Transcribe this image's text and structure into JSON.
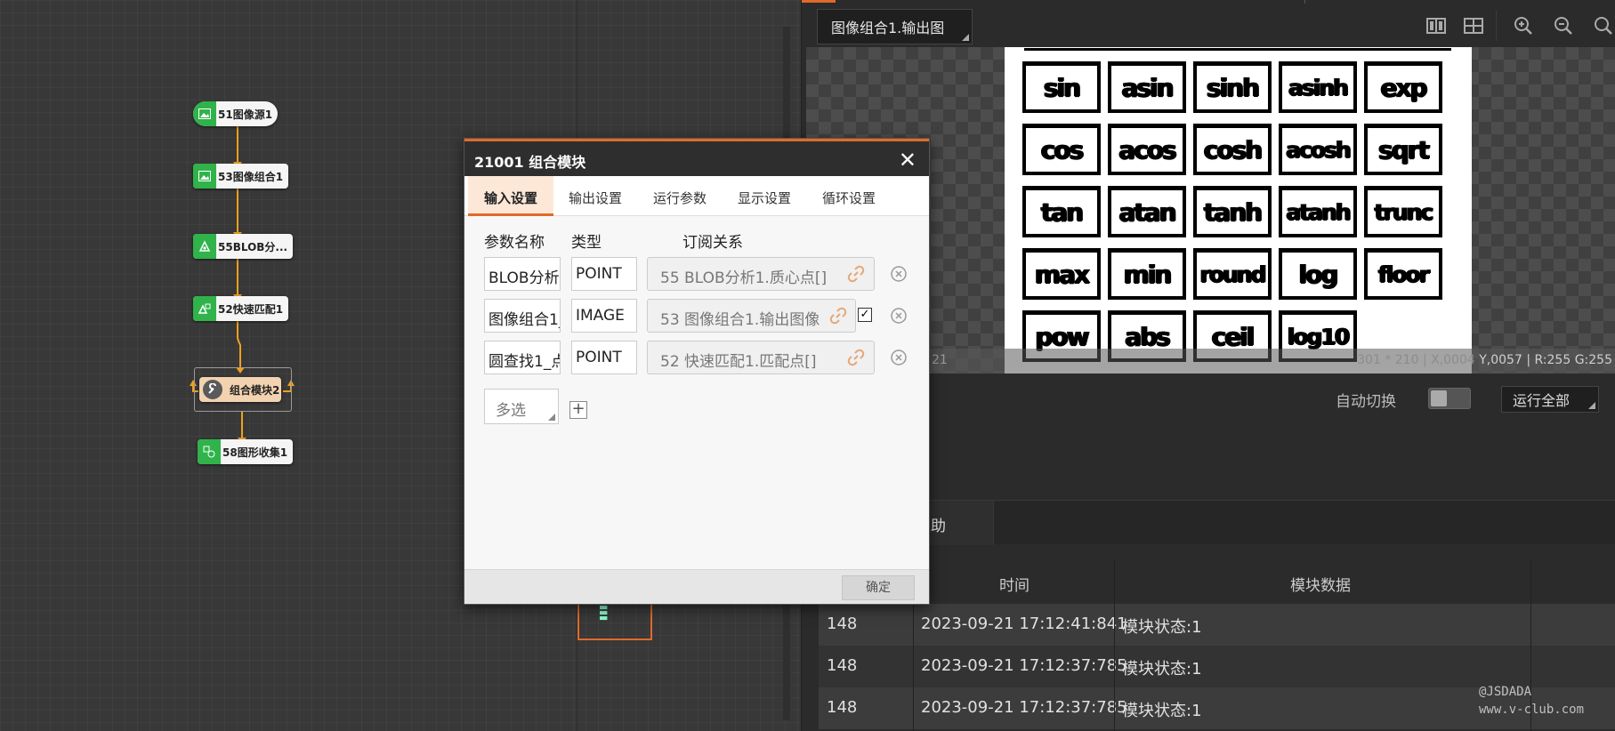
{
  "flow": {
    "nodes": [
      {
        "id": "n1",
        "label": "51图像源1"
      },
      {
        "id": "n2",
        "label": "53图像组合1"
      },
      {
        "id": "n3",
        "label": "55BLOB分..."
      },
      {
        "id": "n4",
        "label": "52快速匹配1"
      },
      {
        "id": "n5",
        "label": "组合模块2"
      },
      {
        "id": "n6",
        "label": "58图形收集1"
      }
    ]
  },
  "dialog": {
    "title": "21001 组合模块",
    "close": "✕",
    "tabs": [
      "输入设置",
      "输出设置",
      "运行参数",
      "显示设置",
      "循环设置"
    ],
    "columns": {
      "name": "参数名称",
      "type": "类型",
      "subscription": "订阅关系"
    },
    "params": [
      {
        "name": "BLOB分析",
        "type": "POINT",
        "subscription": "55 BLOB分析1.质心点[]",
        "checked": false
      },
      {
        "name": "图像组合1_",
        "type": "IMAGE",
        "subscription": "53 图像组合1.输出图像",
        "checked": true
      },
      {
        "name": "圆查找1_点",
        "type": "POINT",
        "subscription": "52 快速匹配1.匹配点[]",
        "checked": false
      }
    ],
    "multi_select": "多选",
    "add": "+",
    "confirm": "确定"
  },
  "viewer": {
    "tab_label": "图像组合1.输出图",
    "preview_words": [
      "sin",
      "asin",
      "sinh",
      "asinh",
      "exp",
      "cos",
      "acos",
      "cosh",
      "acosh",
      "sqrt",
      "tan",
      "atan",
      "tanh",
      "atanh",
      "trunc",
      "max",
      "min",
      "round",
      "log",
      "floor",
      "pow",
      "abs",
      "ceil",
      "log10"
    ],
    "status_left": "21",
    "status_size": "301 * 210",
    "status_x": "X,0004",
    "status_y": "Y,0057",
    "status_r": "R:255",
    "status_g": "G:255"
  },
  "controls": {
    "auto_switch": "自动切换",
    "run_all": "运行全部"
  },
  "bottom": {
    "help_tab": "帮助",
    "table": {
      "headers": [
        "时间",
        "模块数据"
      ],
      "rows": [
        {
          "id": "148",
          "time": "2023-09-21 17:12:41:841",
          "data": "模块状态:1"
        },
        {
          "id": "148",
          "time": "2023-09-21 17:12:37:785",
          "data": "模块状态:1"
        },
        {
          "id": "148",
          "time": "2023-09-21 17:12:37:785",
          "data": "模块状态:1"
        }
      ]
    }
  },
  "watermark": {
    "line1": "@JSDADA",
    "line2": "www.v-club.com"
  },
  "colors": {
    "accent": "#e06a2a",
    "node_green": "#2fb34a"
  }
}
